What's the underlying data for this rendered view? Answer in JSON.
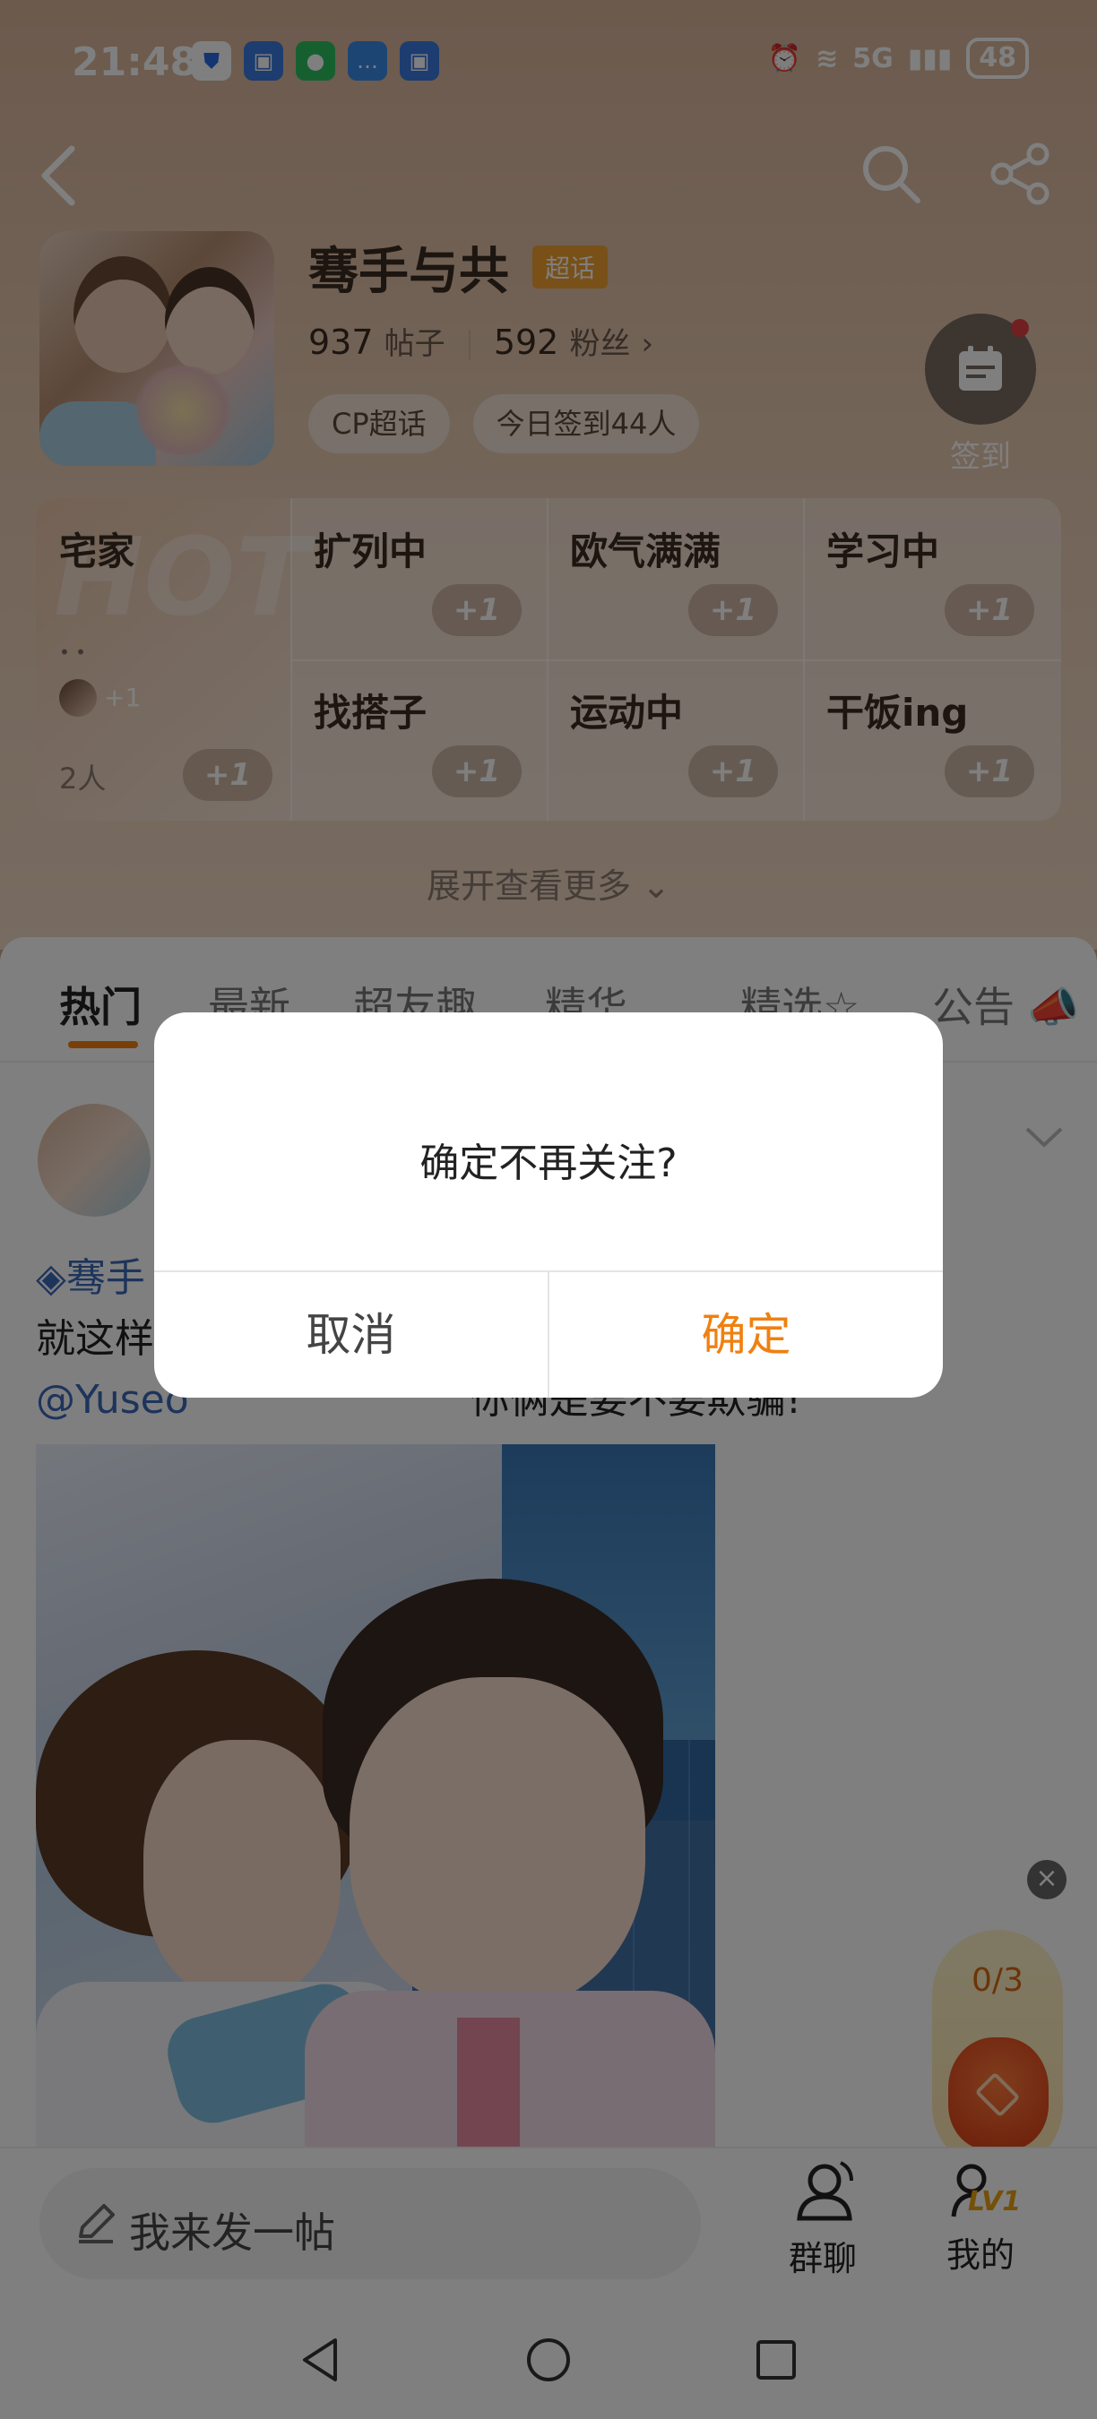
{
  "status_bar": {
    "time": "21:48",
    "battery": "48",
    "network": "5G",
    "app_icons": [
      "shield-icon",
      "app-icon",
      "wechat-icon",
      "message-icon",
      "app-icon"
    ]
  },
  "topic": {
    "title": "骞手与共",
    "badge": "超话",
    "posts_count": "937",
    "posts_label": "帖子",
    "fans_count": "592",
    "fans_label": "粉丝",
    "tags": [
      "CP超话",
      "今日签到44人"
    ],
    "checkin_label": "签到"
  },
  "mood_grid": {
    "first": {
      "name": "宅家",
      "dots": "• •",
      "avatar_plus": "+1",
      "count": "2人",
      "plus": "+1"
    },
    "cells": [
      {
        "name": "扩列中",
        "plus": "+1"
      },
      {
        "name": "欧气满满",
        "plus": "+1"
      },
      {
        "name": "学习中",
        "plus": "+1"
      },
      {
        "name": "找搭子",
        "plus": "+1"
      },
      {
        "name": "运动中",
        "plus": "+1"
      },
      {
        "name": "干饭ing",
        "plus": "+1"
      }
    ],
    "expand_label": "展开查看更多"
  },
  "tabs": [
    "热门",
    "最新",
    "超友趣",
    "精华",
    "精选☆",
    "公告"
  ],
  "post": {
    "line1": "◈骞手",
    "line2": "就这样",
    "line3": "@Yuseo",
    "line3_rest": "你俩是要不要欺骗!"
  },
  "reward": {
    "progress": "0/3"
  },
  "bottom_bar": {
    "compose_label": "我来发一帖",
    "group_chat_label": "群聊",
    "mine_label": "我的",
    "level_badge": "LV1"
  },
  "dialog": {
    "message": "确定不再关注?",
    "cancel_label": "取消",
    "confirm_label": "确定"
  },
  "colors": {
    "accent": "#f08010",
    "link": "#3a68b8"
  }
}
